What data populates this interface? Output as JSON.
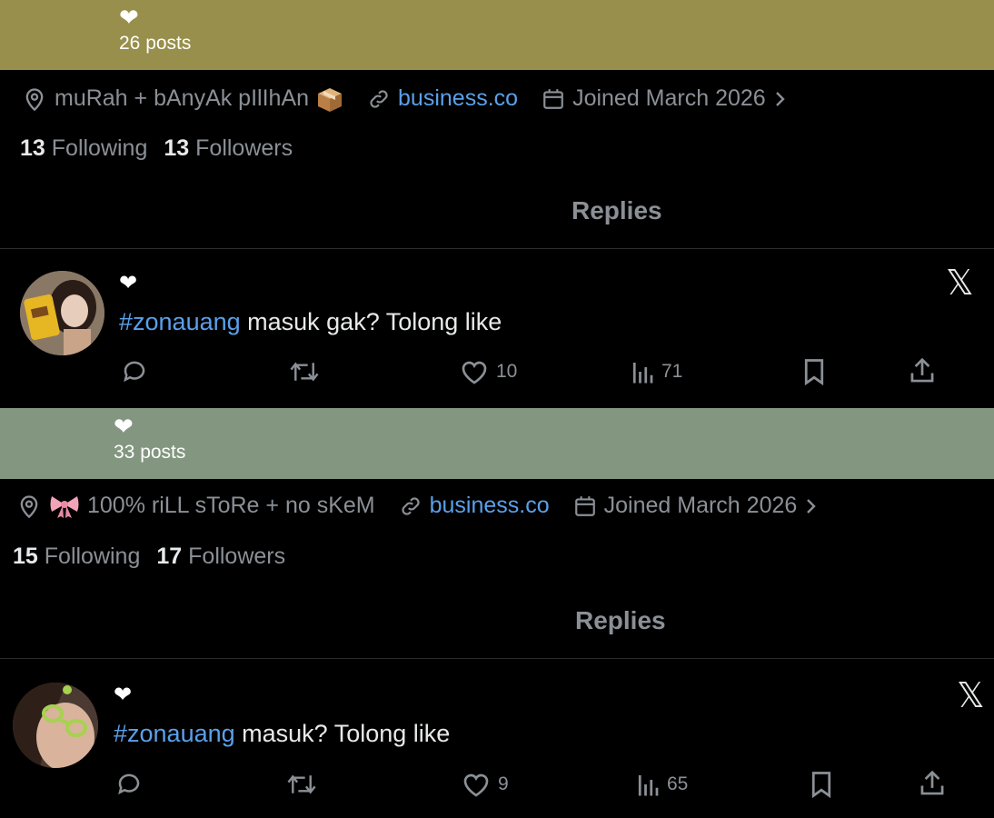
{
  "profiles": [
    {
      "banner_color": "#978f4b",
      "heart": "❤",
      "posts": "26 posts",
      "location": "muRah + bAnyAk pIlIhAn",
      "website": "business.co",
      "joined": "Joined March 2026",
      "following_count": "13",
      "following_label": "Following",
      "followers_count": "13",
      "followers_label": "Followers",
      "tab": "Replies",
      "tweet": {
        "heart": "❤",
        "hashtag": "#zonauang",
        "text": " masuk gak? Tolong like",
        "likes": "10",
        "views": "71",
        "x_logo": "𝕏"
      }
    },
    {
      "banner_color": "#839780",
      "heart": "❤",
      "posts": "33 posts",
      "location": "100% riLL sToRe + no sKeM",
      "website": "business.co",
      "joined": "Joined March 2026",
      "following_count": "15",
      "following_label": "Following",
      "followers_count": "17",
      "followers_label": "Followers",
      "tab": "Replies",
      "tweet": {
        "heart": "❤",
        "hashtag": "#zonauang",
        "text": " masuk? Tolong like",
        "likes": "9",
        "views": "65",
        "x_logo": "𝕏"
      }
    }
  ],
  "colors": {
    "link": "#5aa0ea",
    "muted": "#8b9096",
    "text": "#e7e9ea",
    "background": "#000000"
  },
  "icons": [
    "location-pin-icon",
    "link-icon",
    "calendar-icon",
    "chevron-right-icon",
    "reply-icon",
    "retweet-icon",
    "like-icon",
    "views-icon",
    "bookmark-icon",
    "share-icon",
    "x-logo-icon",
    "package-emoji-icon",
    "ribbon-emoji-icon"
  ]
}
